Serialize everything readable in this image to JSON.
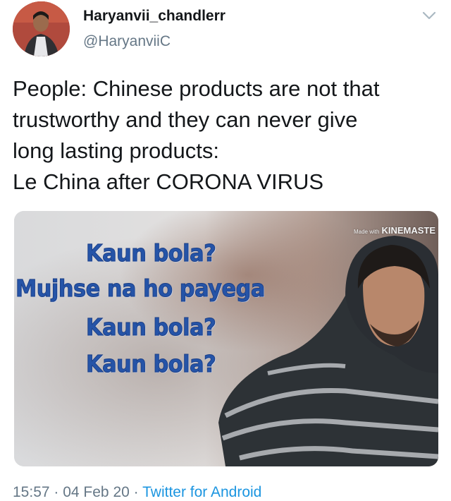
{
  "user": {
    "display_name": "Haryanvii_chandlerr",
    "handle": "@HaryanviiC"
  },
  "tweet": {
    "lines": [
      "People: Chinese products are not that",
      "trustworthy and they can never give",
      "long lasting products:",
      "Le China after CORONA VIRUS"
    ]
  },
  "media": {
    "watermark_prefix": "Made with",
    "watermark_brand": "KINEMASTE",
    "caption_lines": [
      "Kaun bola?",
      "Mujhse na ho payega",
      "Kaun bola?",
      "Kaun bola?"
    ]
  },
  "meta": {
    "time": "15:57",
    "separator": " · ",
    "date": "04 Feb 20",
    "source": "Twitter for Android"
  },
  "colors": {
    "text": "#14171a",
    "secondary": "#657786",
    "link": "#1b95e0",
    "caption": "#2554a8"
  },
  "icons": {
    "menu": "chevron-down-icon"
  }
}
